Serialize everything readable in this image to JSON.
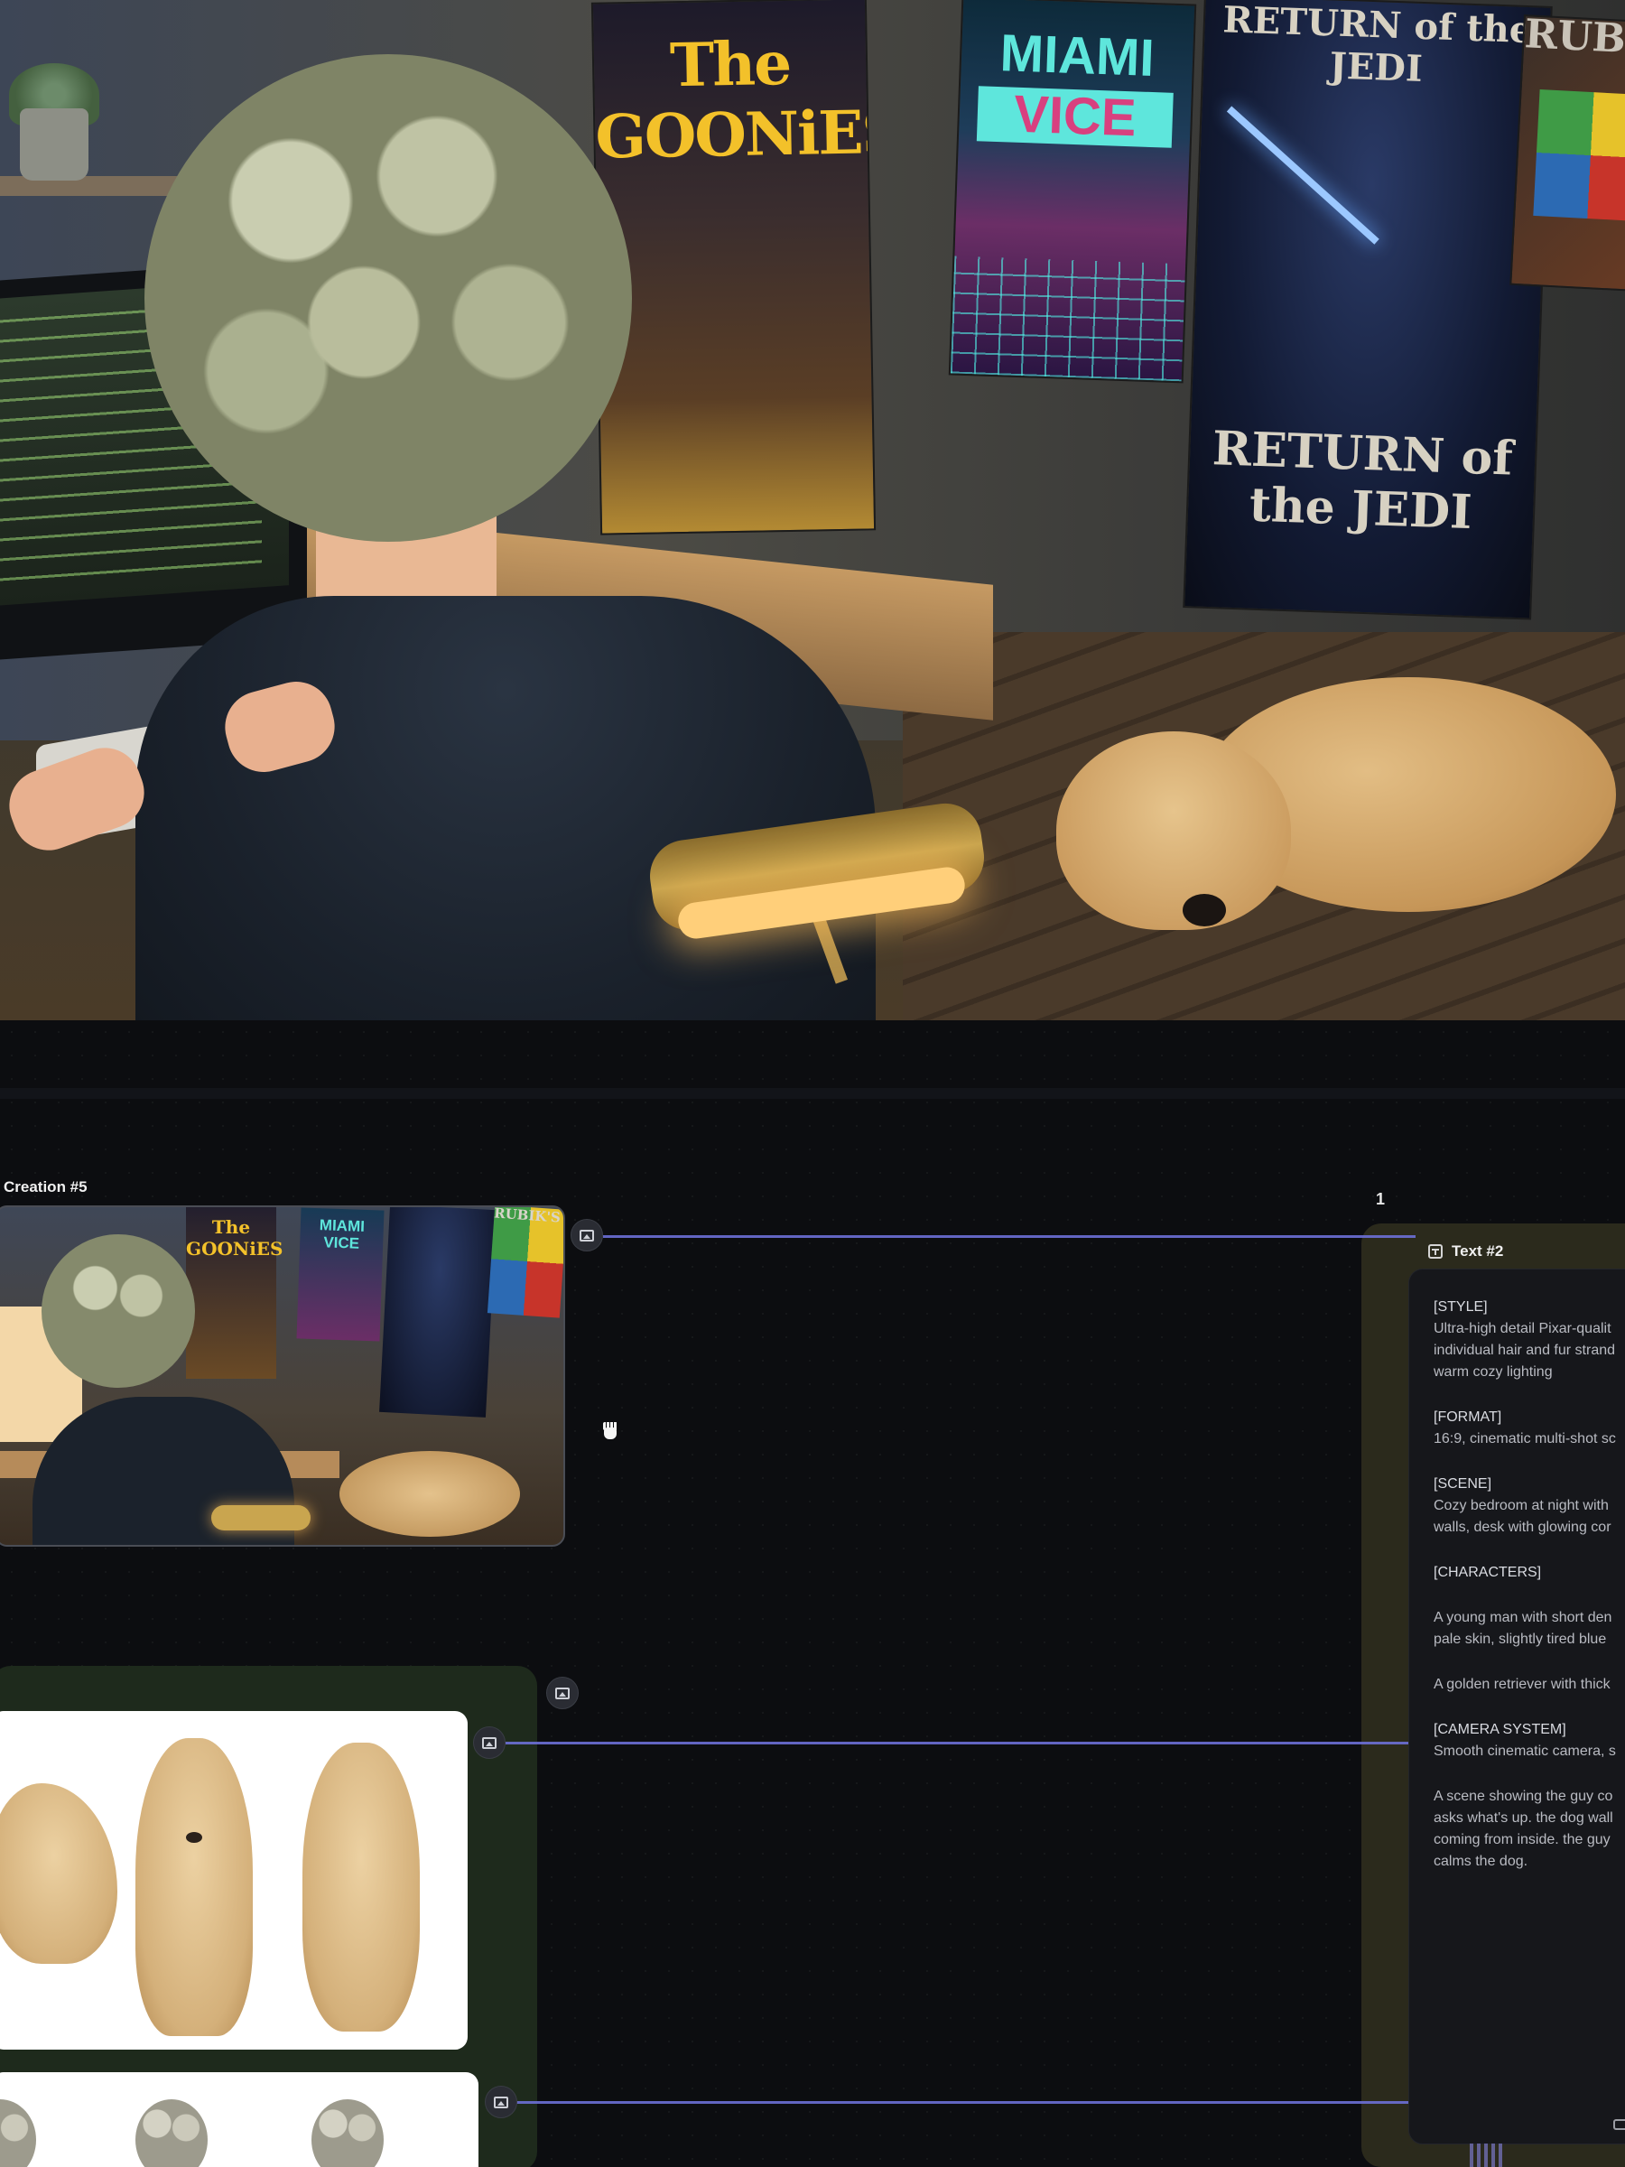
{
  "hero": {
    "posters": {
      "goonies": "The GOONiES",
      "miami_top": "MIAMI",
      "miami_bottom": "VICE",
      "jedi_top": "RETURN of the JEDI",
      "jedi_bottom": "RETURN of the JEDI",
      "rubik": "RUBIK'S"
    }
  },
  "canvas": {
    "counter": "1",
    "nodes": {
      "creation": {
        "title": "Creation #5"
      },
      "thumb_posters": {
        "goonies": "The GOONiES",
        "miami": "MIAMI VICE",
        "rubik": "RUBIK'S"
      },
      "text": {
        "title": "Text #2",
        "lines": [
          {
            "kind": "sec",
            "text": "[STYLE]"
          },
          {
            "kind": "txt",
            "text": "Ultra-high detail Pixar-qualit"
          },
          {
            "kind": "txt",
            "text": "individual hair and fur strand"
          },
          {
            "kind": "txt",
            "text": "warm cozy lighting"
          },
          {
            "kind": "gap",
            "text": ""
          },
          {
            "kind": "sec",
            "text": "[FORMAT]"
          },
          {
            "kind": "txt",
            "text": "16:9, cinematic multi-shot sc"
          },
          {
            "kind": "gap",
            "text": ""
          },
          {
            "kind": "sec",
            "text": "[SCENE]"
          },
          {
            "kind": "txt",
            "text": "Cozy bedroom at night with"
          },
          {
            "kind": "txt",
            "text": "walls, desk with glowing cor"
          },
          {
            "kind": "gap",
            "text": ""
          },
          {
            "kind": "sec",
            "text": "[CHARACTERS]"
          },
          {
            "kind": "gap",
            "text": ""
          },
          {
            "kind": "txt",
            "text": "A young man with short den"
          },
          {
            "kind": "txt",
            "text": "pale skin, slightly tired blue"
          },
          {
            "kind": "gap",
            "text": ""
          },
          {
            "kind": "txt",
            "text": "A golden retriever with thick"
          },
          {
            "kind": "gap",
            "text": ""
          },
          {
            "kind": "sec",
            "text": "[CAMERA SYSTEM]"
          },
          {
            "kind": "txt",
            "text": "Smooth cinematic camera, s"
          },
          {
            "kind": "gap",
            "text": ""
          },
          {
            "kind": "txt",
            "text": "A scene showing the guy co"
          },
          {
            "kind": "txt",
            "text": "asks what's up. the dog wall"
          },
          {
            "kind": "txt",
            "text": "coming from inside. the guy"
          },
          {
            "kind": "txt",
            "text": "calms the dog."
          }
        ]
      }
    }
  },
  "colors": {
    "edge": "#6c6fd6",
    "canvas_bg": "#0c0d10",
    "green_group": "#1e2a1c",
    "text_group": "#2b2a1c"
  },
  "icons": [
    "image-port-icon",
    "document-icon",
    "hand-cursor-icon",
    "comment-icon"
  ]
}
